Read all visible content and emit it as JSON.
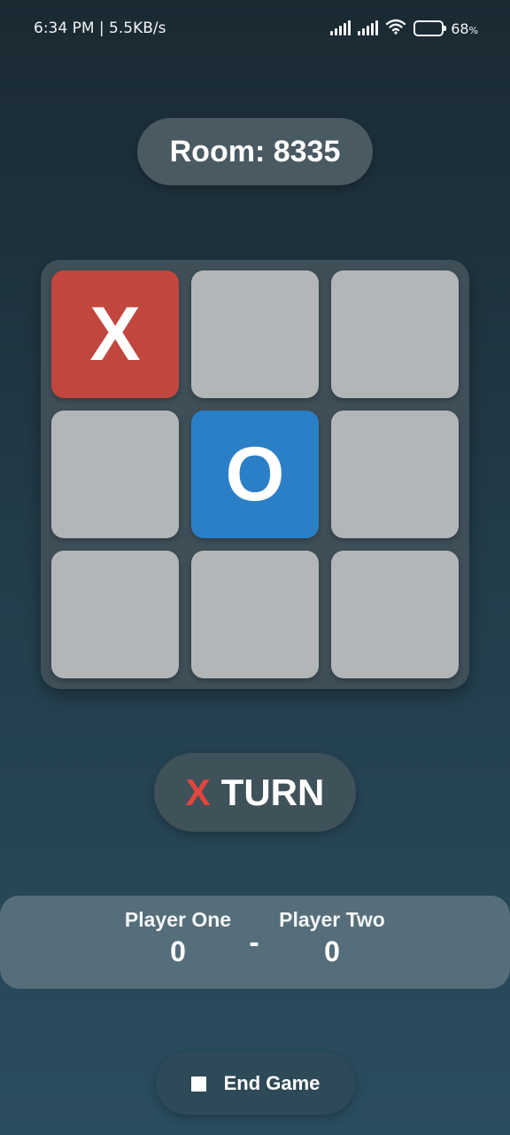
{
  "status_bar": {
    "time_speed": "6:34 PM | 5.5KB/s",
    "battery_percent": "68",
    "battery_unit": "%",
    "battery_level": 0.68,
    "icons": [
      "signal-icon",
      "signal-icon",
      "wifi-icon",
      "battery-icon"
    ]
  },
  "room": {
    "label": "Room: 8335"
  },
  "board": {
    "cells": [
      {
        "mark": "X",
        "state": "x"
      },
      {
        "mark": "",
        "state": "empty"
      },
      {
        "mark": "",
        "state": "empty"
      },
      {
        "mark": "",
        "state": "empty"
      },
      {
        "mark": "O",
        "state": "o"
      },
      {
        "mark": "",
        "state": "empty"
      },
      {
        "mark": "",
        "state": "empty"
      },
      {
        "mark": "",
        "state": "empty"
      },
      {
        "mark": "",
        "state": "empty"
      }
    ]
  },
  "turn": {
    "symbol": "X",
    "label": "TURN"
  },
  "score": {
    "player_one": {
      "name": "Player One",
      "score": "0"
    },
    "separator": "-",
    "player_two": {
      "name": "Player Two",
      "score": "0"
    }
  },
  "end_game": {
    "label": "End Game",
    "icon": "stop-icon"
  },
  "colors": {
    "x_cell": "#c0463e",
    "o_cell": "#2b7fc7",
    "empty_cell": "#b3b6b8",
    "turn_symbol": "#e2463d"
  }
}
